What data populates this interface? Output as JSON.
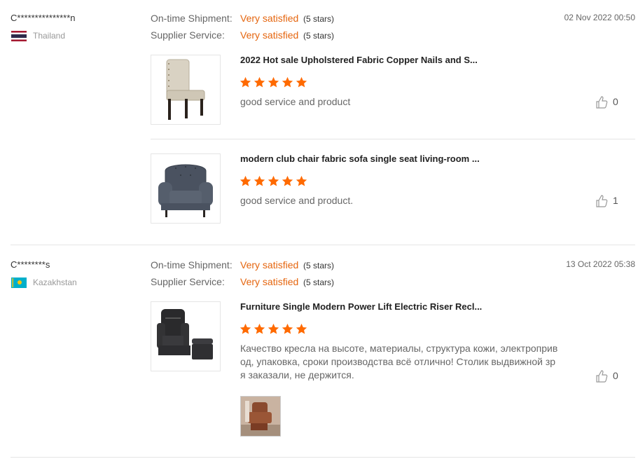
{
  "reviews": [
    {
      "user": "C***************n",
      "country": "Thailand",
      "date": "02 Nov 2022 00:50",
      "ratings": [
        {
          "label": "On-time Shipment:",
          "value": "Very satisfied",
          "stars": "(5 stars)"
        },
        {
          "label": "Supplier Service:",
          "value": "Very satisfied",
          "stars": "(5 stars)"
        }
      ],
      "products": [
        {
          "title": "2022 Hot sale Upholstered Fabric Copper Nails and S...",
          "rating": 5,
          "comment": "good service and product",
          "likes": "0",
          "image_icon": "beige-dining-chair"
        },
        {
          "title": "modern club chair fabric sofa single seat living-room ...",
          "rating": 5,
          "comment": "good service and product.",
          "likes": "1",
          "image_icon": "grey-armchair"
        }
      ]
    },
    {
      "user": "C********s",
      "country": "Kazakhstan",
      "date": "13 Oct 2022 05:38",
      "ratings": [
        {
          "label": "On-time Shipment:",
          "value": "Very satisfied",
          "stars": "(5 stars)"
        },
        {
          "label": "Supplier Service:",
          "value": "Very satisfied",
          "stars": "(5 stars)"
        }
      ],
      "products": [
        {
          "title": "Furniture Single Modern Power Lift Electric Riser Recl...",
          "rating": 5,
          "comment": "Качество кресла на высоте, материалы, структура кожи, электроприв од, упаковка, сроки производства всё отлично! Столик выдвижной зр я заказали, не держится.",
          "likes": "0",
          "image_icon": "black-recliner"
        }
      ]
    }
  ],
  "colors": {
    "accent": "#e5650e",
    "star": "#ff6a00"
  }
}
